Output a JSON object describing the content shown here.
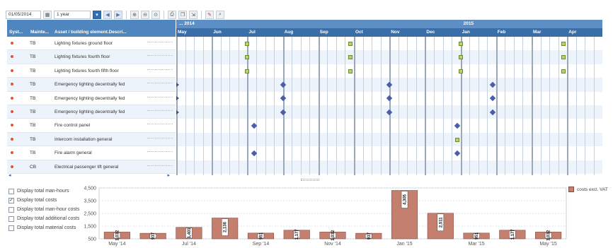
{
  "toolbar": {
    "date_value": "01/05/2014",
    "period_value": "1 year",
    "icons": [
      "calendar-icon",
      "dropdown-icon",
      "prev-arrow-icon",
      "next-arrow-icon",
      "zoom-in-icon",
      "zoom-out-icon",
      "zoom-reset-icon",
      "print-icon",
      "copy-icon",
      "export-icon",
      "edit-icon",
      "search-icon"
    ]
  },
  "grid": {
    "headers": [
      "Syst...",
      "Mainte...",
      "Asset / building element.Descri..."
    ],
    "rows": [
      {
        "maint": "TB",
        "desc": "Lighting fixtures ground floor"
      },
      {
        "maint": "TB",
        "desc": "Lighting fixtures fourth floor"
      },
      {
        "maint": "TB",
        "desc": "Lighting fixtures fourth fifth floor"
      },
      {
        "maint": "TB",
        "desc": "Emergency lighting decentrally fed"
      },
      {
        "maint": "TB",
        "desc": "Emergency lighting decentrally fed"
      },
      {
        "maint": "TB",
        "desc": "Emergency lighting decentrally fed"
      },
      {
        "maint": "TB",
        "desc": "Fire control panel"
      },
      {
        "maint": "TB",
        "desc": "Intercom installation general"
      },
      {
        "maint": "TB",
        "desc": "Fire alarm general"
      },
      {
        "maint": "CB",
        "desc": "Electrical passenger lift general"
      }
    ]
  },
  "gantt": {
    "years": [
      {
        "label": "... 2014",
        "month": 0
      },
      {
        "label": "2015",
        "month": 8
      }
    ],
    "months": [
      "May",
      "Jun",
      "Jul",
      "Aug",
      "Sep",
      "Oct",
      "Nov",
      "Dec",
      "Jan",
      "Feb",
      "Mar",
      "Apr"
    ],
    "markers": [
      {
        "row": 0,
        "type": "square",
        "months": [
          2.0,
          4.9,
          8.0,
          10.9
        ]
      },
      {
        "row": 1,
        "type": "square",
        "months": [
          2.0,
          4.9,
          8.0,
          10.9
        ]
      },
      {
        "row": 2,
        "type": "square",
        "months": [
          2.0,
          4.9,
          8.0,
          10.9
        ]
      },
      {
        "row": 3,
        "type": "diamond",
        "months": [
          3.0,
          6.0,
          8.9
        ]
      },
      {
        "row": 4,
        "type": "diamond",
        "months": [
          3.0,
          6.0,
          8.9
        ]
      },
      {
        "row": 5,
        "type": "diamond",
        "months": [
          3.0,
          6.0,
          8.9
        ]
      },
      {
        "row": 6,
        "type": "diamond",
        "months": [
          2.2,
          7.9
        ]
      },
      {
        "row": 7,
        "type": "square",
        "months": [
          7.9
        ]
      },
      {
        "row": 8,
        "type": "diamond",
        "months": [
          2.2,
          7.9
        ]
      }
    ],
    "edge_arrows": [
      3,
      4,
      5
    ]
  },
  "options": [
    {
      "label": "Display total man-hours",
      "checked": false
    },
    {
      "label": "Display total costs",
      "checked": true
    },
    {
      "label": "Display total man-hour costs",
      "checked": false
    },
    {
      "label": "Display total additional costs",
      "checked": false
    },
    {
      "label": "Display total material costs",
      "checked": false
    }
  ],
  "legend_label": "costs excl. VAT",
  "colors": {
    "header": "#4f86bf",
    "bar": "#c47f6f",
    "bar_dark": "#8a4a3d",
    "marker_square": "#b7d36a",
    "marker_diamond": "#4a5ea8"
  },
  "chart_data": {
    "type": "bar",
    "categories": [
      "May '14",
      "Jun '14",
      "Jul '14",
      "Aug '14",
      "Sep '14",
      "Oct '14",
      "Nov '14",
      "Dec '14",
      "Jan '15",
      "Feb '15",
      "Mar '15",
      "Apr '15",
      "May '15"
    ],
    "values": [
      1032,
      937,
      1401,
      2136,
      951,
      1177,
      1032,
      937,
      4305,
      2511,
      951,
      1177,
      1032
    ],
    "data_labels": [
      "1,032",
      "937",
      "1,401",
      "2,136",
      "951",
      "1,177",
      "1,032",
      "937",
      "4,305",
      "2,511",
      "951",
      "1,177",
      "1,032"
    ],
    "x_tick_labels": [
      "May '14",
      "Jul '14",
      "Sep '14",
      "Nov '14",
      "Jan '15",
      "Mar '15",
      "May '15"
    ],
    "y_ticks": [
      "4,500",
      "3,500",
      "2,500",
      "1,500",
      "500"
    ],
    "ylim": [
      500,
      4500
    ],
    "series": [
      {
        "name": "costs excl. VAT",
        "values": [
          1032,
          937,
          1401,
          2136,
          951,
          1177,
          1032,
          937,
          4305,
          2511,
          951,
          1177,
          1032
        ]
      }
    ],
    "legend_position": "top-right",
    "grid": true
  }
}
